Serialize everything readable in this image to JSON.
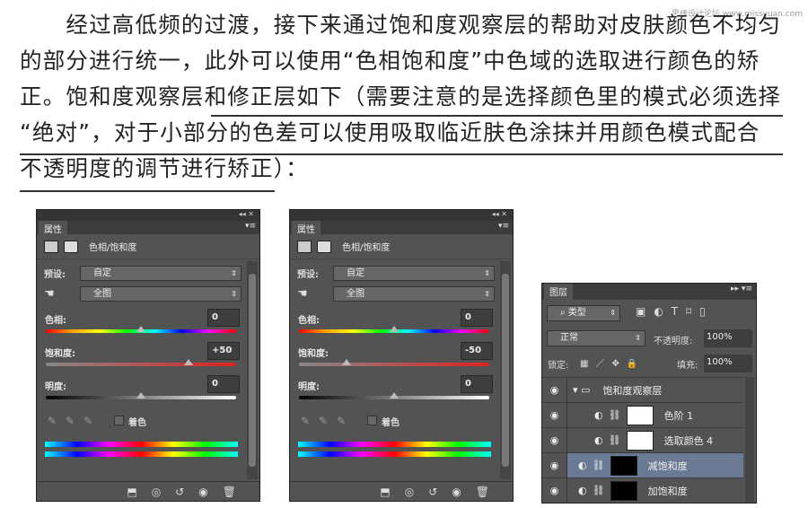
{
  "watermark": "思缘设计论坛 www.missyuan.com",
  "paragraph": {
    "lines": [
      "　　经过高低频的过渡，接下来通过饱和度观察层的帮助对皮肤颜色不均匀",
      "的部分进行统一，此外可以使用“色相饱和度”中色域的选取进行颜色的矫",
      "正。饱和度观察层和修正层如下（需要注意的是选择颜色里的模式必须选择",
      " “绝对”，对于小部分的色差可以使用吸取临近肤色涂抹并用颜色模式配合",
      "不透明度的调节进行矫正）："
    ]
  },
  "properties_panels": [
    {
      "tab": "属性",
      "title": "色相/饱和度",
      "preset_label": "预设:",
      "preset": "自定",
      "range": "全图",
      "hue_label": "色相:",
      "hue": "0",
      "hue_level": 0,
      "sat_label": "饱和度:",
      "sat": "+50",
      "sat_level": 50,
      "light_label": "明度:",
      "light": "0",
      "light_level": 0,
      "colorize": "着色"
    },
    {
      "tab": "属性",
      "title": "色相/饱和度",
      "preset_label": "预设:",
      "preset": "自定",
      "range": "全图",
      "hue_label": "色相:",
      "hue": "0",
      "hue_level": 0,
      "sat_label": "饱和度:",
      "sat": "-50",
      "sat_level": -50,
      "light_label": "明度:",
      "light": "0",
      "light_level": 0,
      "colorize": "着色"
    }
  ],
  "layers_panel": {
    "tab": "图层",
    "filter": "类型",
    "blend_mode": "正常",
    "opacity_label": "不透明度:",
    "opacity": "100%",
    "lock_label": "锁定:",
    "fill_label": "填充:",
    "fill": "100%",
    "layers": [
      {
        "name": "饱和度观察层",
        "type": "group"
      },
      {
        "name": "色阶 1",
        "type": "adjustment",
        "mask": "white"
      },
      {
        "name": "选取颜色 4",
        "type": "adjustment",
        "mask": "white"
      },
      {
        "name": "减饱和度",
        "type": "adjustment",
        "mask": "black",
        "selected": true
      },
      {
        "name": "加饱和度",
        "type": "adjustment",
        "mask": "black"
      }
    ]
  },
  "colors": {
    "panel_bg": "#535353",
    "selected_layer": "#6a7a94"
  }
}
